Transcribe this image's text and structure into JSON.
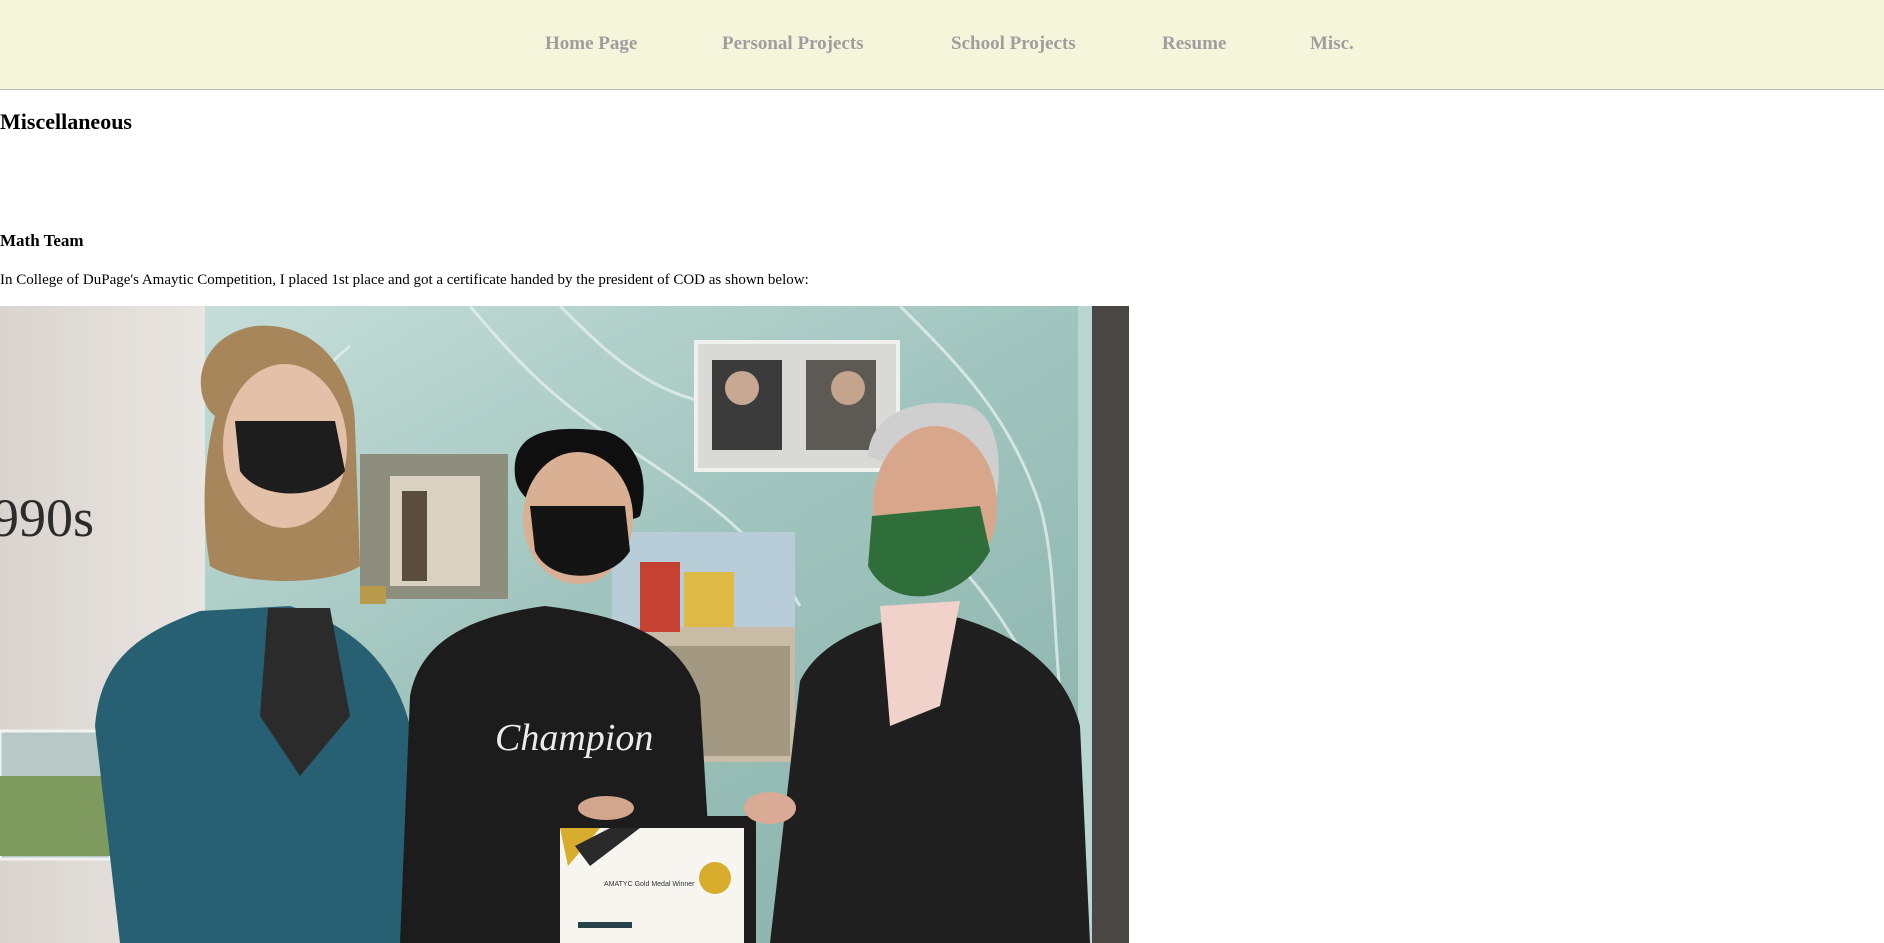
{
  "nav": {
    "items": [
      {
        "label": "Home Page"
      },
      {
        "label": "Personal Projects"
      },
      {
        "label": "School Projects"
      },
      {
        "label": "Resume"
      },
      {
        "label": "Misc."
      }
    ]
  },
  "page": {
    "title": "Miscellaneous"
  },
  "sections": [
    {
      "heading": "Math Team",
      "text": "In College of DuPage's Amaytic Competition, I placed 1st place and got a certificate handed by the president of COD as shown below:",
      "photo": {
        "wall_text": "990s",
        "hoodie_text": "Champion",
        "certificate_title": "AMATYC Gold Medal Winner"
      }
    }
  ],
  "colors": {
    "nav_background": "#f5f5dc",
    "nav_text": "#9e9e9e"
  }
}
